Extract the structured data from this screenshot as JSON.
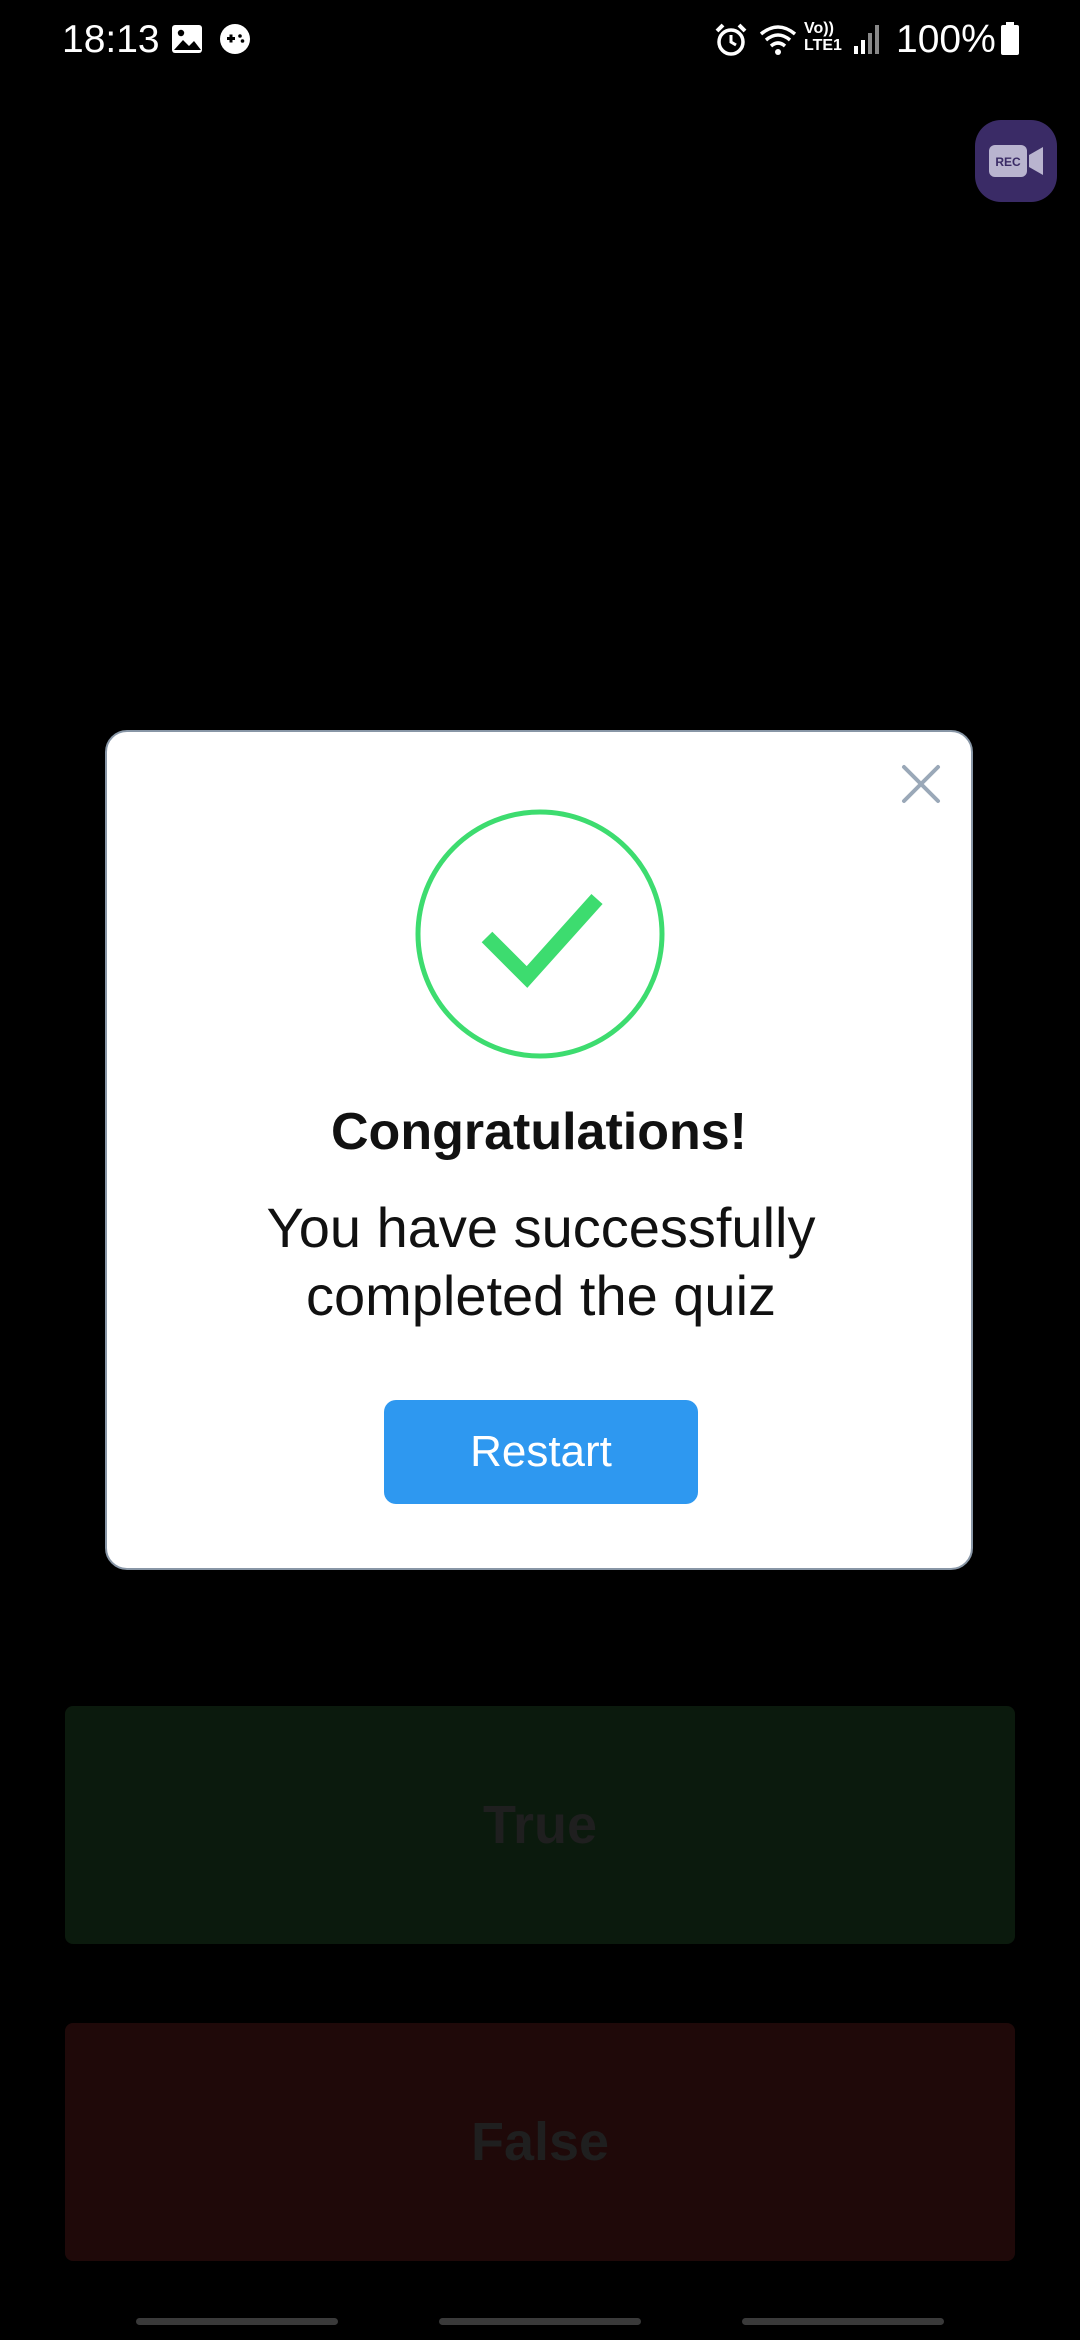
{
  "status_bar": {
    "time": "18:13",
    "battery": "100%",
    "icons": [
      "gallery-icon",
      "game-icon",
      "alarm-icon",
      "wifi-icon",
      "volte-icon",
      "signal-icon",
      "battery-icon"
    ],
    "volte_label": "Vo))\nLTE1"
  },
  "rec_button": {
    "label": "REC",
    "icon": "video-camera-icon",
    "color": "#3a2b66"
  },
  "modal": {
    "close_icon": "close-icon",
    "success_icon": "checkmark-circle-icon",
    "title": "Congratulations!",
    "message": "You have successfully completed the quiz",
    "restart_label": "Restart",
    "accent_color": "#2e98f0",
    "success_color": "#3ddc6f"
  },
  "answers": {
    "true_label": "True",
    "false_label": "False"
  }
}
